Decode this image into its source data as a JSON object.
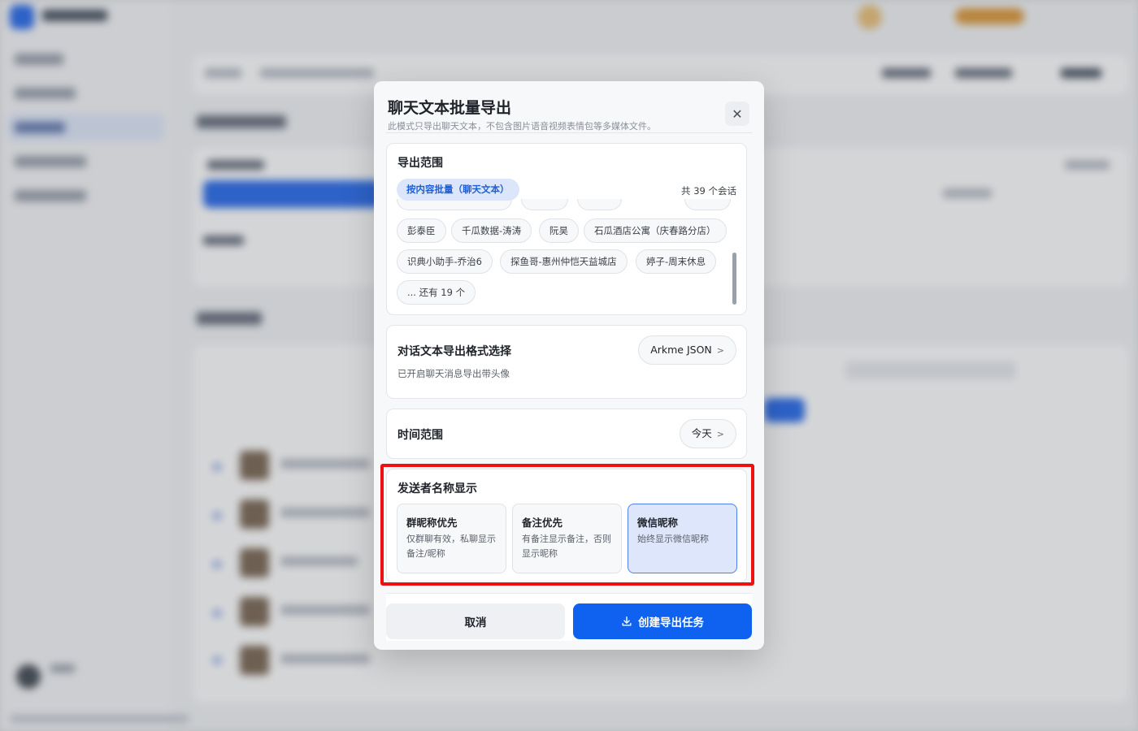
{
  "modal": {
    "title": "聊天文本批量导出",
    "subtitle": "此模式只导出聊天文本，不包含图片语音视频表情包等多媒体文件。",
    "close_icon": "close-icon"
  },
  "scope": {
    "title": "导出范围",
    "badge": "按内容批量（聊天文本）",
    "count": "共 39 个会话",
    "chips": [
      "彭泰臣",
      "千瓜数据-涛涛",
      "阮昊",
      "石瓜酒店公寓（庆春路分店）",
      "识典小助手-乔治6",
      "探鱼哥-惠州仲恺天益城店",
      "婷子-周末休息",
      "... 还有 19 个"
    ]
  },
  "format": {
    "title": "对话文本导出格式选择",
    "subtitle": "已开启聊天消息导出带头像",
    "value": "Arkme JSON",
    "arrow": ">"
  },
  "time_range": {
    "title": "时间范围",
    "value": "今天",
    "arrow": ">"
  },
  "sender": {
    "title": "发送者名称显示",
    "options": [
      {
        "title": "群昵称优先",
        "desc": "仅群聊有效，私聊显示备注/昵称",
        "selected": false
      },
      {
        "title": "备注优先",
        "desc": "有备注显示备注，否则显示昵称",
        "selected": false
      },
      {
        "title": "微信昵称",
        "desc": "始终显示微信昵称",
        "selected": true
      }
    ]
  },
  "footer": {
    "cancel_label": "取消",
    "create_label": "创建导出任务",
    "download_icon": "download-icon"
  },
  "colors": {
    "primary": "#0f62f0",
    "selected_bg": "#dde6fb",
    "highlight": "#ee1111"
  }
}
